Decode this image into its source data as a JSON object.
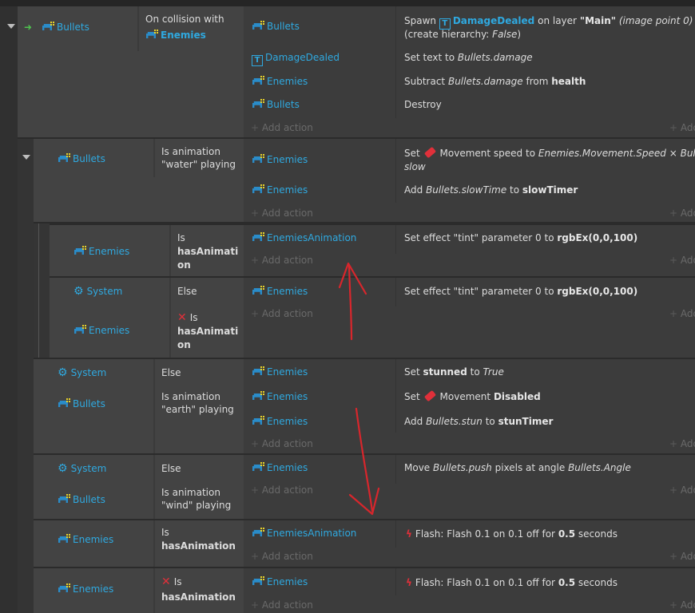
{
  "events": [
    {
      "conditions": [
        {
          "object": "Bullets",
          "icon": "bullets-sprite-icon"
        },
        {
          "text": "On collision with",
          "object": "Enemies",
          "icon": "enemies-sprite-icon"
        }
      ],
      "actions": [
        {
          "object": "Bullets",
          "text_a": "Spawn",
          "obj2": "DamageDealed",
          "text_b": "on layer",
          "bold": "\"Main\"",
          "ital": "(image point 0)",
          "line2a": "(create hierarchy:",
          "line2b": "False",
          "line2c": ")"
        },
        {
          "object": "DamageDealed",
          "text_a": "Set text to",
          "ital": "Bullets.damage"
        },
        {
          "object": "Enemies",
          "text_a": "Subtract",
          "ital": "Bullets.damage",
          "text_b": "from",
          "bold": "health"
        },
        {
          "object": "Bullets",
          "text_a": "Destroy"
        }
      ],
      "add_action": "Add action",
      "add_short": "Add"
    },
    {
      "conditions": [
        {
          "object": "Bullets",
          "text": "Is animation \"water\" playing"
        }
      ],
      "actions": [
        {
          "object": "Enemies",
          "text_a": "Set",
          "text_b": "Movement speed to",
          "ital": "Enemies.Movement.Speed × Bullets.",
          "line2": "slow"
        },
        {
          "object": "Enemies",
          "text_a": "Add",
          "ital": "Bullets.slowTime",
          "text_b": "to",
          "bold": "slowTimer"
        }
      ]
    },
    {
      "conditions": [
        {
          "object": "Enemies",
          "text": "Is",
          "bold": "hasAnimati",
          "bold2": "on"
        }
      ],
      "actions": [
        {
          "object": "EnemiesAnimation",
          "text_a": "Set effect \"tint\" parameter 0 to",
          "bold": "rgbEx(0,0,100)"
        }
      ]
    },
    {
      "conditions": [
        {
          "object": "System",
          "text": "Else"
        },
        {
          "object": "Enemies",
          "text": "Is",
          "bold": "hasAnimati",
          "bold2": "on"
        }
      ],
      "actions": [
        {
          "object": "Enemies",
          "text_a": "Set effect \"tint\" parameter 0 to",
          "bold": "rgbEx(0,0,100)"
        }
      ]
    },
    {
      "conditions": [
        {
          "object": "System",
          "text": "Else"
        },
        {
          "object": "Bullets",
          "text": "Is animation \"earth\" playing"
        }
      ],
      "actions": [
        {
          "object": "Enemies",
          "text_a": "Set",
          "bold": "stunned",
          "text_b": "to",
          "ital": "True"
        },
        {
          "object": "Enemies",
          "text_a": "Set",
          "text_b": "Movement",
          "bold": "Disabled"
        },
        {
          "object": "Enemies",
          "text_a": "Add",
          "ital": "Bullets.stun",
          "text_b": "to",
          "bold": "stunTimer"
        }
      ]
    },
    {
      "conditions": [
        {
          "object": "System",
          "text": "Else"
        },
        {
          "object": "Bullets",
          "text": "Is animation \"wind\" playing"
        }
      ],
      "actions": [
        {
          "object": "Enemies",
          "text_a": "Move",
          "ital": "Bullets.push",
          "text_b": "pixels at angle",
          "ital2": "Bullets.Angle"
        }
      ]
    },
    {
      "conditions": [
        {
          "object": "Enemies",
          "text": "Is",
          "bold": "hasAnimation"
        }
      ],
      "actions": [
        {
          "object": "EnemiesAnimation",
          "text_a": "Flash: Flash 0.1 on 0.1 off for",
          "bold": "0.5",
          "text_b": "seconds"
        }
      ]
    },
    {
      "conditions": [
        {
          "object": "Enemies",
          "text": "Is",
          "bold": "hasAnimation"
        }
      ],
      "actions": [
        {
          "object": "Enemies",
          "text_a": "Flash: Flash 0.1 on 0.1 off for",
          "bold": "0.5",
          "text_b": "seconds"
        }
      ]
    }
  ],
  "colors": {
    "object": "#2fa9e0",
    "arrow": "#e0303a",
    "bg": "#2b2b2b"
  }
}
